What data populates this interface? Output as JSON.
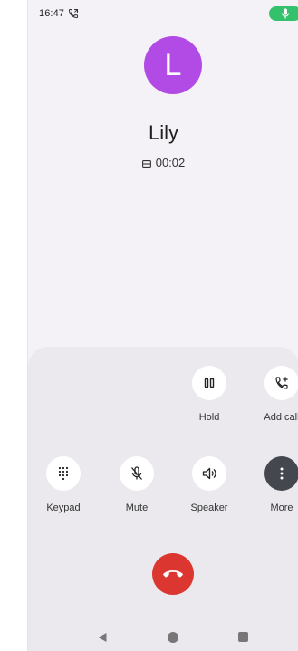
{
  "status_bar": {
    "time": "16:47",
    "call_icon": "phone-in-call-icon",
    "mic_indicator_icon": "mic-icon",
    "mic_indicator_color": "#33c26b"
  },
  "caller": {
    "avatar_letter": "L",
    "avatar_color": "#b24be5",
    "name": "Lily",
    "sim_icon": "sim-icon",
    "duration": "00:02"
  },
  "controls": {
    "hold": {
      "label": "Hold",
      "icon": "pause-icon"
    },
    "add_call": {
      "label": "Add call",
      "icon": "add-call-icon"
    },
    "keypad": {
      "label": "Keypad",
      "icon": "dialpad-icon"
    },
    "mute": {
      "label": "Mute",
      "icon": "mic-off-icon"
    },
    "speaker": {
      "label": "Speaker",
      "icon": "speaker-icon"
    },
    "more": {
      "label": "More",
      "icon": "more-vert-icon"
    }
  },
  "end_call": {
    "icon": "call-end-icon",
    "color": "#dc3630"
  },
  "nav": {
    "back_icon": "back-icon",
    "home_icon": "home-icon",
    "recents_icon": "recents-icon"
  }
}
